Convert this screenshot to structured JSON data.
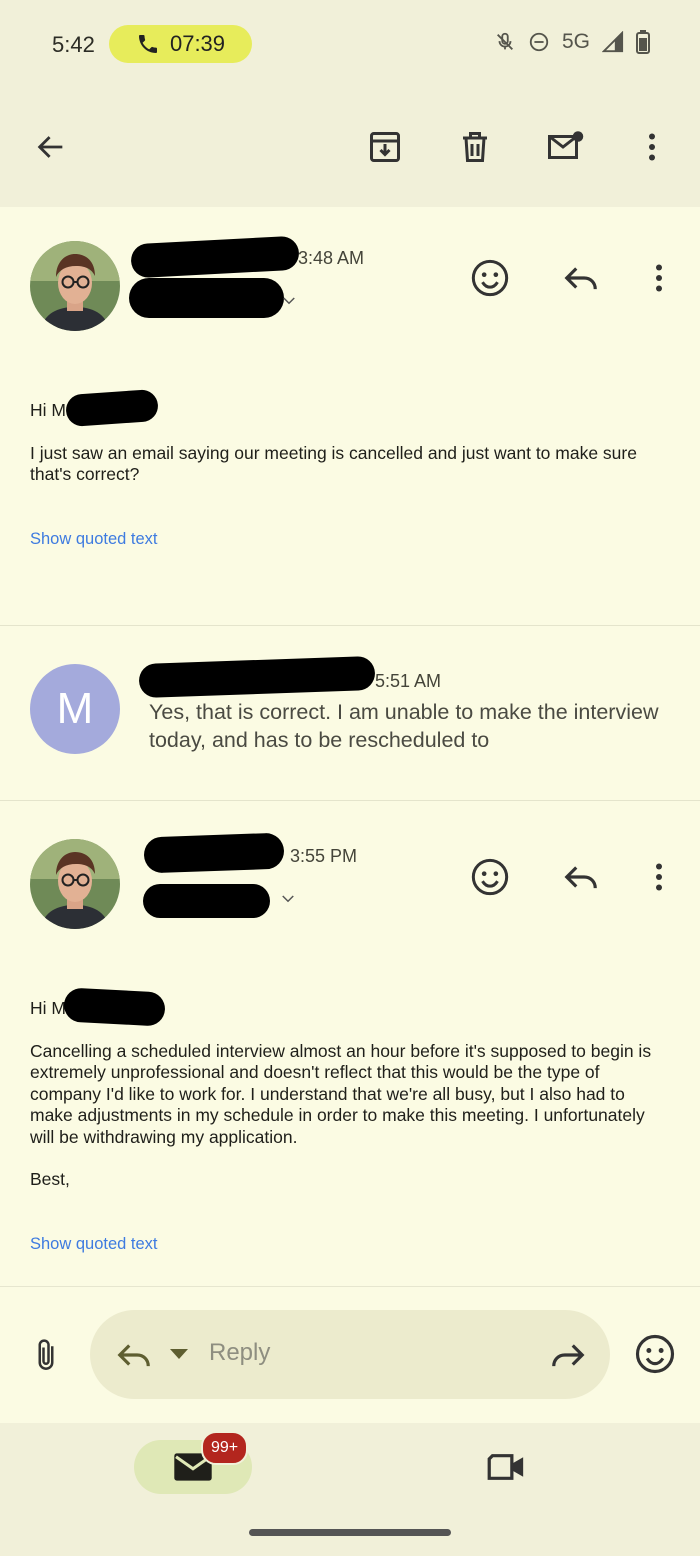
{
  "status_bar": {
    "time": "5:42",
    "call_timer": "07:39",
    "network": "5G"
  },
  "app_bar": {
    "icons": [
      "back-arrow-icon",
      "archive-icon",
      "delete-icon",
      "mark-unread-icon",
      "more-vert-icon"
    ]
  },
  "messages": [
    {
      "time": "3:48 AM",
      "greeting": "Hi M",
      "body": "I just saw an email saying our meeting is cancelled and just want to make sure that's correct?",
      "show_quoted": "Show quoted text"
    },
    {
      "avatar_letter": "M",
      "time": "5:51 AM",
      "preview": "Yes, that is correct. I am unable to make the interview today, and has to be rescheduled to"
    },
    {
      "time": "3:55 PM",
      "greeting": "Hi M",
      "body": "Cancelling a scheduled interview almost an hour before it's supposed to begin is extremely unprofessional and doesn't reflect that this would be the type of company I'd like to work for. I understand that we're all busy, but I also had to make adjustments in my schedule in order to make this meeting. I unfortunately will be withdrawing my application.",
      "signoff": "Best,",
      "show_quoted": "Show quoted text"
    }
  ],
  "composer": {
    "placeholder": "Reply"
  },
  "bottom_nav": {
    "mail_badge": "99+"
  },
  "colors": {
    "background": "#fbfbe3",
    "bars": "#f1f0d9",
    "call_pill": "#e7ec5b",
    "link": "#3e7be0",
    "avatar_m": "#a4aadc",
    "badge": "#b3261e"
  }
}
